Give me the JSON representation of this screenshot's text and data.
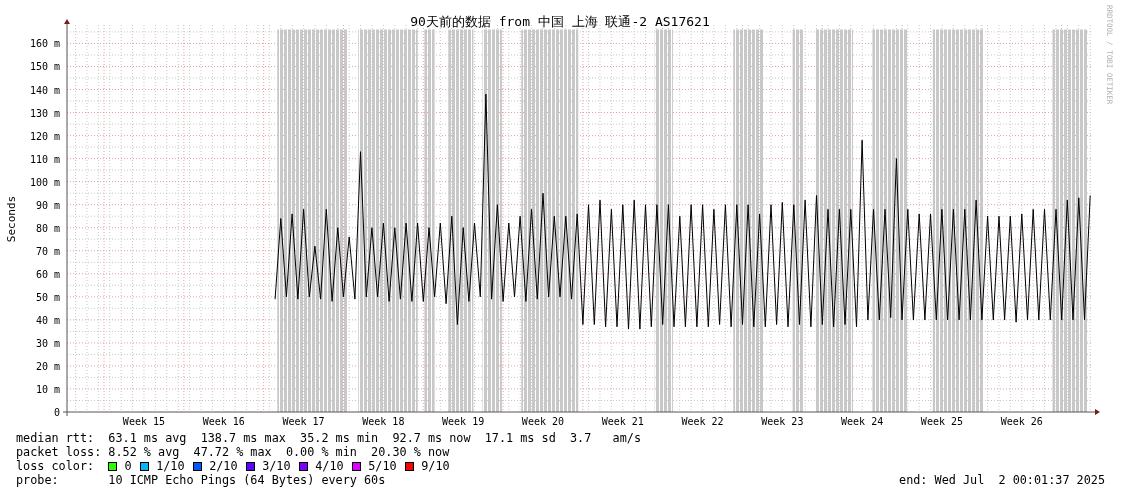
{
  "graph": {
    "credit": "RRDTOOL / TOBI OETIKER",
    "chart_data": {
      "type": "line",
      "title": "90天前的数据 from 中国 上海 联通-2 AS17621",
      "ylabel": "Seconds",
      "ylim": [
        0,
        168
      ],
      "yticks": [
        {
          "value": 0,
          "label": "0"
        },
        {
          "value": 10,
          "label": "10 m"
        },
        {
          "value": 20,
          "label": "20 m"
        },
        {
          "value": 30,
          "label": "30 m"
        },
        {
          "value": 40,
          "label": "40 m"
        },
        {
          "value": 50,
          "label": "50 m"
        },
        {
          "value": 60,
          "label": "60 m"
        },
        {
          "value": 70,
          "label": "70 m"
        },
        {
          "value": 80,
          "label": "80 m"
        },
        {
          "value": 90,
          "label": "90 m"
        },
        {
          "value": 100,
          "label": "100 m"
        },
        {
          "value": 110,
          "label": "110 m"
        },
        {
          "value": 120,
          "label": "120 m"
        },
        {
          "value": 130,
          "label": "130 m"
        },
        {
          "value": 140,
          "label": "140 m"
        },
        {
          "value": 150,
          "label": "150 m"
        },
        {
          "value": 160,
          "label": "160 m"
        }
      ],
      "categories": [
        null,
        null,
        null,
        null,
        null,
        null,
        null,
        null,
        null,
        null,
        null,
        null,
        null,
        "Week 15",
        null,
        null,
        null,
        null,
        null,
        null,
        null,
        null,
        null,
        null,
        null,
        null,
        null,
        "Week 16",
        null,
        null,
        null,
        null,
        null,
        null,
        null,
        null,
        null,
        null,
        null,
        null,
        null,
        "Week 17",
        null,
        null,
        null,
        null,
        null,
        null,
        null,
        null,
        null,
        null,
        null,
        null,
        null,
        "Week 18",
        null,
        null,
        null,
        null,
        null,
        null,
        null,
        null,
        null,
        null,
        null,
        null,
        null,
        "Week 19",
        null,
        null,
        null,
        null,
        null,
        null,
        null,
        null,
        null,
        null,
        null,
        null,
        null,
        "Week 20",
        null,
        null,
        null,
        null,
        null,
        null,
        null,
        null,
        null,
        null,
        null,
        null,
        null,
        "Week 21",
        null,
        null,
        null,
        null,
        null,
        null,
        null,
        null,
        null,
        null,
        null,
        null,
        null,
        "Week 22",
        null,
        null,
        null,
        null,
        null,
        null,
        null,
        null,
        null,
        null,
        null,
        null,
        null,
        "Week 23",
        null,
        null,
        null,
        null,
        null,
        null,
        null,
        null,
        null,
        null,
        null,
        null,
        null,
        "Week 24",
        null,
        null,
        null,
        null,
        null,
        null,
        null,
        null,
        null,
        null,
        null,
        null,
        null,
        "Week 25",
        null,
        null,
        null,
        null,
        null,
        null,
        null,
        null,
        null,
        null,
        null,
        null,
        null,
        "Week 26",
        null,
        null,
        null,
        null,
        null,
        null,
        null,
        null,
        null,
        null,
        null,
        null
      ],
      "series": [
        {
          "color": "#000000",
          "values": [
            null,
            null,
            null,
            null,
            null,
            null,
            null,
            null,
            null,
            null,
            null,
            null,
            null,
            null,
            null,
            null,
            null,
            null,
            null,
            null,
            null,
            null,
            null,
            null,
            null,
            null,
            null,
            null,
            null,
            null,
            null,
            null,
            null,
            null,
            null,
            null,
            49,
            84,
            50,
            86,
            49,
            88,
            50,
            72,
            49,
            88,
            48,
            80,
            50,
            76,
            49,
            113,
            50,
            80,
            50,
            82,
            48,
            80,
            49,
            82,
            48,
            82,
            48,
            80,
            50,
            82,
            47,
            85,
            38,
            80,
            48,
            82,
            50,
            138,
            49,
            90,
            48,
            82,
            50,
            85,
            48,
            88,
            49,
            95,
            50,
            85,
            50,
            85,
            49,
            86,
            38,
            90,
            38,
            92,
            37,
            88,
            37,
            90,
            36,
            92,
            36,
            90,
            37,
            90,
            38,
            90,
            37,
            85,
            37,
            90,
            37,
            90,
            37,
            88,
            38,
            90,
            37,
            90,
            38,
            90,
            37,
            86,
            37,
            90,
            38,
            91,
            37,
            90,
            38,
            92,
            37,
            94,
            38,
            88,
            37,
            88,
            38,
            88,
            37,
            118,
            40,
            88,
            40,
            88,
            41,
            110,
            40,
            88,
            40,
            86,
            40,
            86,
            40,
            88,
            40,
            88,
            40,
            88,
            40,
            92,
            40,
            85,
            40,
            85,
            40,
            85,
            39,
            86,
            40,
            88,
            40,
            88,
            40,
            88,
            40,
            92,
            40,
            93,
            40,
            94
          ]
        }
      ],
      "grid": true
    }
  },
  "legend": {
    "median_rtt": {
      "label": "median rtt:",
      "text": "63.1 ms avg  138.7 ms max  35.2 ms min  92.7 ms now  17.1 ms sd  3.7   am/s"
    },
    "packet_loss": {
      "label": "packet loss:",
      "text": "8.52 % avg  47.72 % max  0.00 % min  20.30 % now"
    },
    "loss_color_label": "loss color:",
    "loss_colors": [
      {
        "label": "0",
        "color": "#26ff00"
      },
      {
        "label": "1/10",
        "color": "#00b8ff"
      },
      {
        "label": "2/10",
        "color": "#0059ff"
      },
      {
        "label": "3/10",
        "color": "#5e00ff"
      },
      {
        "label": "4/10",
        "color": "#7e00ff"
      },
      {
        "label": "5/10",
        "color": "#dd00ff"
      },
      {
        "label": "9/10",
        "color": "#ff0000"
      }
    ],
    "probe": {
      "label": "probe:",
      "text": "10 ICMP Echo Pings (64 Bytes) every 60s"
    },
    "end": "end: Wed Jul  2 00:01:37 2025"
  }
}
